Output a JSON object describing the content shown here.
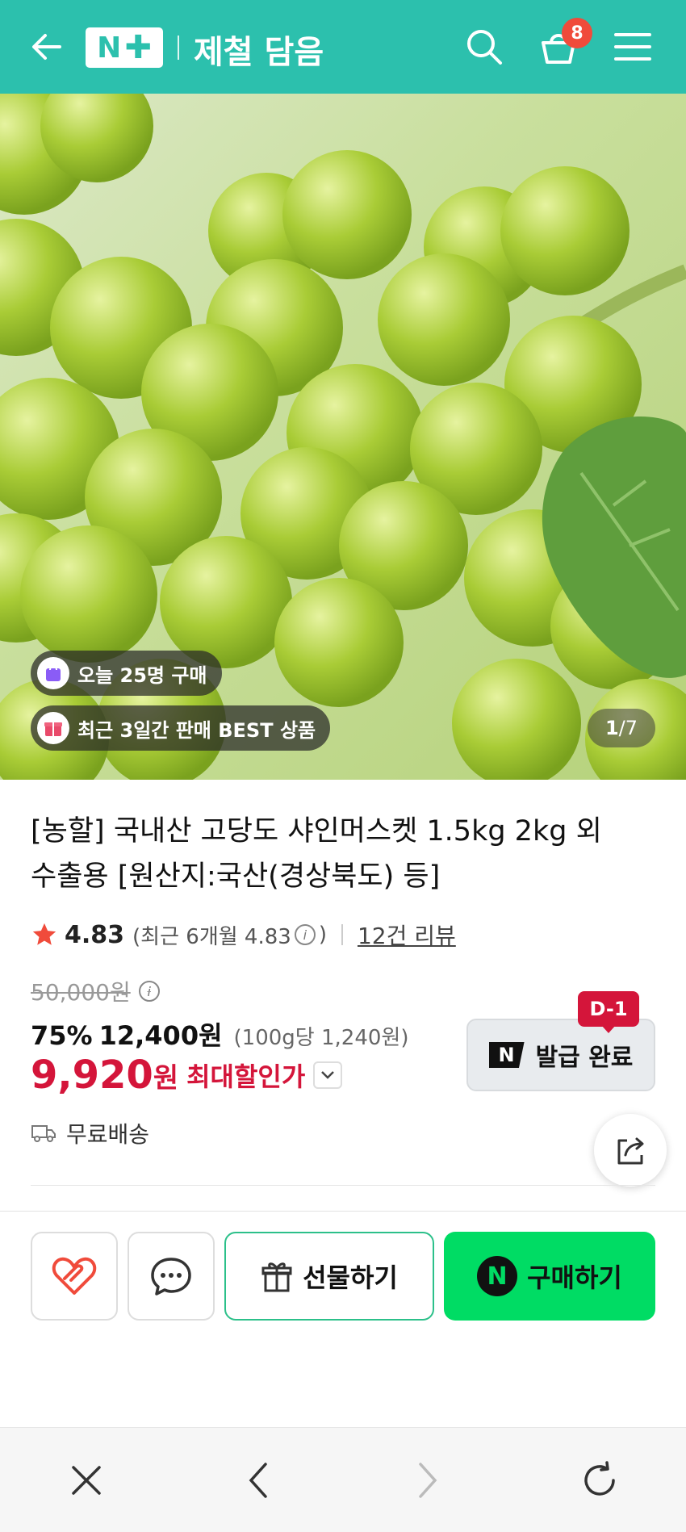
{
  "header": {
    "logo_text": "N",
    "store_name": "제철 담음",
    "cart_count": "8",
    "accent_color": "#2cc0ad"
  },
  "hero": {
    "badge_today": "오늘 25명 구매",
    "badge_best": "최근 3일간 판매 BEST 상품",
    "page_current": "1",
    "page_total": "/7"
  },
  "product": {
    "title": "[농할] 국내산 고당도 샤인머스켓 1.5kg 2kg 외 수출용 [원산지:국산(경상북도) 등]",
    "rating": "4.83",
    "recent_rating": "(최근 6개월 4.83",
    "recent_rating_close": ")",
    "review_count": "12건 리뷰",
    "original_price": "50,000원",
    "discount_rate": "75%",
    "sale_price": "12,400원",
    "unit_price": "(100g당 1,240원)",
    "final_price": "9,920",
    "final_won": "원",
    "max_discount_label": "최대할인가",
    "delivery": "무료배송"
  },
  "coupon": {
    "label": "발급 완료",
    "dday": "D-1",
    "logo": "N"
  },
  "actions": {
    "gift_label": "선물하기",
    "buy_label": "구매하기",
    "buy_logo": "N",
    "buy_color": "#00dc64"
  },
  "icons": [
    "back-arrow-icon",
    "search-icon",
    "cart-icon",
    "menu-icon",
    "heart-icon",
    "chat-icon",
    "gift-icon",
    "share-icon",
    "truck-icon",
    "close-icon",
    "chevron-left-icon",
    "chevron-right-icon",
    "reload-icon"
  ]
}
